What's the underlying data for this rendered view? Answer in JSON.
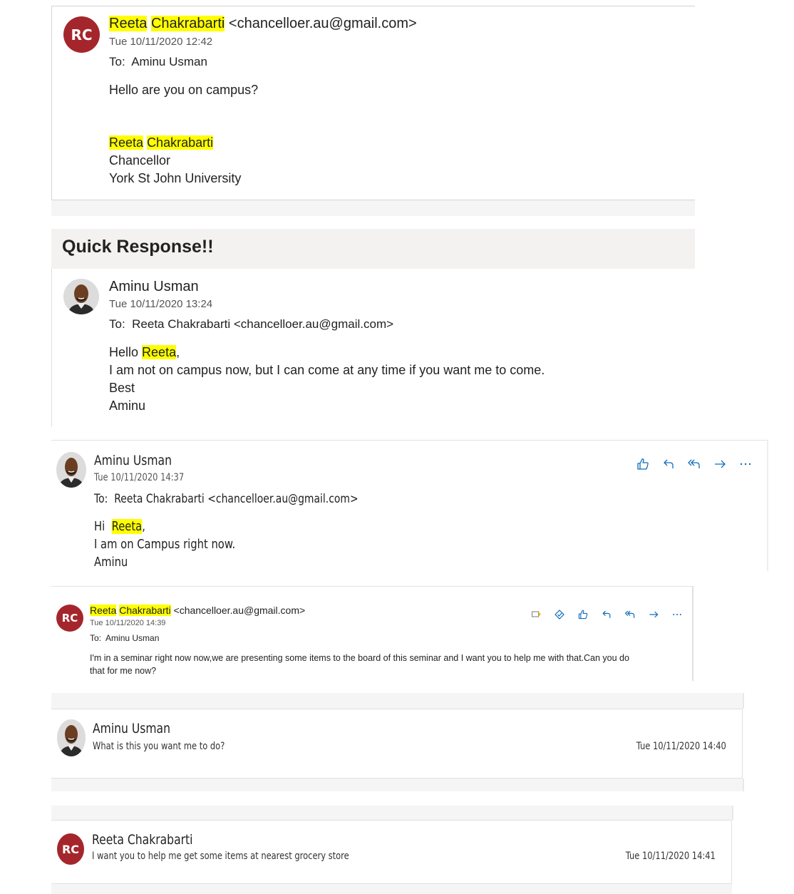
{
  "email1": {
    "avatar": "RC",
    "sender_first": "Reeta",
    "sender_last": "Chakrabarti",
    "sender_email": "<chancelloer.au@gmail.com>",
    "date": "Tue 10/11/2020 12:42",
    "to_label": "To:",
    "to_name": "Aminu Usman",
    "body": "Hello are you on campus?",
    "sig_first": "Reeta",
    "sig_last": "Chakrabarti",
    "sig_title": "Chancellor",
    "sig_org": "York St John University"
  },
  "heading": "Quick Response!!",
  "email2": {
    "sender": "Aminu Usman",
    "date": "Tue 10/11/2020 13:24",
    "to_label": "To:",
    "to": "Reeta Chakrabarti <chancelloer.au@gmail.com>",
    "greet": "Hello",
    "greet_name": "Reeta",
    "greet_punct": ",",
    "line1": "I am not on campus now, but I can come at any time if you want me to come.",
    "line2": "Best",
    "line3": "Aminu"
  },
  "email3": {
    "sender": "Aminu Usman",
    "date": "Tue 10/11/2020 14:37",
    "to_label": "To:",
    "to": "Reeta Chakrabarti <chancelloer.au@gmail.com>",
    "greet": "Hi",
    "greet_name": "Reeta",
    "greet_punct": ",",
    "line1": "I am on Campus right now.",
    "line2": "Aminu",
    "actions": [
      "like-icon",
      "reply-icon",
      "reply-all-icon",
      "forward-icon",
      "more-icon"
    ]
  },
  "email4": {
    "avatar": "RC",
    "sender_first": "Reeta",
    "sender_last": "Chakrabarti",
    "sender_email": "<chancelloer.au@gmail.com>",
    "date": "Tue 10/11/2020 14:39",
    "to_label": "To:",
    "to_name": "Aminu Usman",
    "body1": "I'm in a seminar right now now,we are presenting some items to the board of this seminar and I want you to help me with that.Can you do",
    "body2": "that for me now?",
    "actions": [
      "flag-icon",
      "immersive-reader-icon",
      "like-icon",
      "reply-icon",
      "reply-all-icon",
      "forward-icon",
      "more-icon"
    ]
  },
  "email5": {
    "sender": "Aminu Usman",
    "preview": "What is this you want me to do?",
    "date": "Tue 10/11/2020 14:40"
  },
  "email6": {
    "avatar": "RC",
    "sender": "Reeta Chakrabarti",
    "preview": "I want you to help me get some items at nearest grocery store",
    "date": "Tue 10/11/2020 14:41"
  },
  "colors": {
    "avatar_red": "#a4262c",
    "highlight": "#ffff00",
    "icon_blue": "#0f6cbd"
  }
}
